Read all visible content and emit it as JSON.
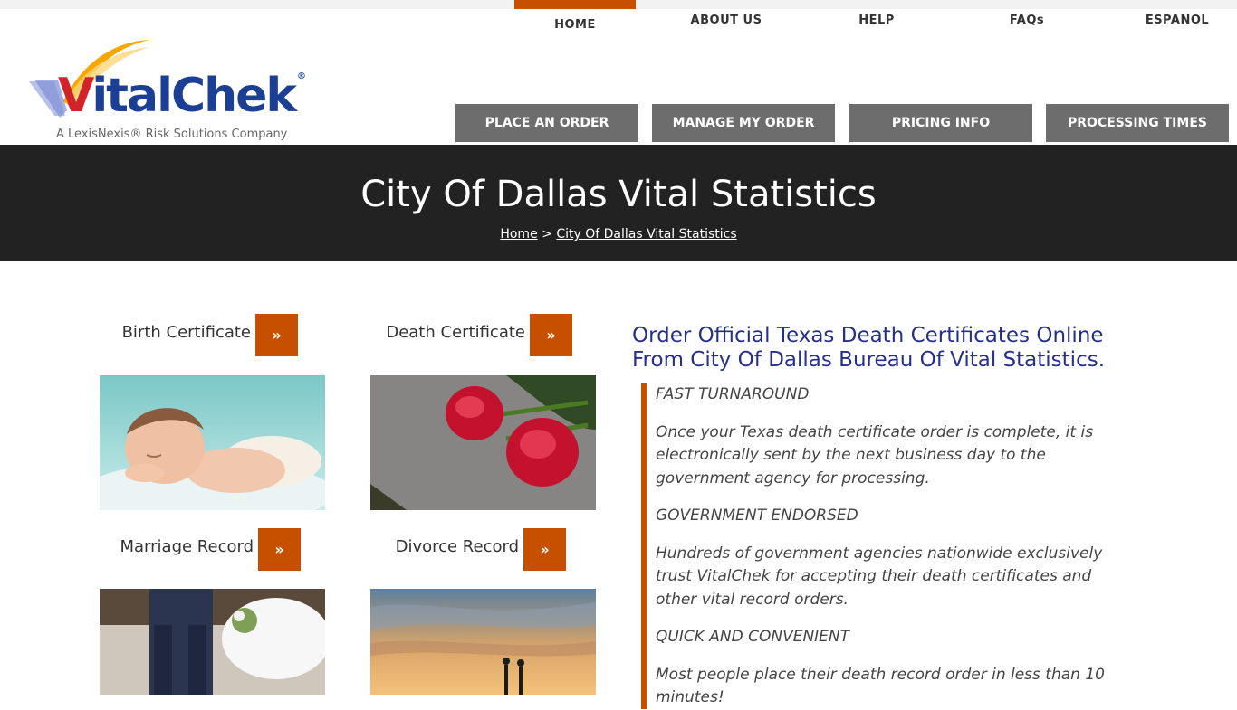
{
  "top_nav": {
    "items": [
      {
        "label": "HOME",
        "active": true
      },
      {
        "label": "ABOUT US"
      },
      {
        "label": "HELP"
      },
      {
        "label": "FAQs"
      },
      {
        "label": "ESPANOL"
      }
    ]
  },
  "logo": {
    "brand_v": "V",
    "brand_rest": "italChek",
    "registered": "®",
    "tagline": "A LexisNexis® Risk Solutions Company"
  },
  "action_nav": {
    "buttons": [
      {
        "label": "PLACE AN ORDER"
      },
      {
        "label": "MANAGE MY ORDER"
      },
      {
        "label": "PRICING INFO"
      },
      {
        "label": "PROCESSING TIMES"
      }
    ]
  },
  "hero": {
    "title": "City Of Dallas Vital Statistics",
    "breadcrumb": {
      "home": "Home",
      "separator": " > ",
      "current": "City Of Dallas Vital Statistics"
    }
  },
  "cards": [
    {
      "label": "Birth Certificate",
      "button": "»",
      "image": "sleeping-baby-photo"
    },
    {
      "label": "Death Certificate",
      "button": "»",
      "image": "red-roses-on-stone-photo"
    },
    {
      "label": "Marriage Record",
      "button": "»",
      "image": "wedding-couple-photo"
    },
    {
      "label": "Divorce Record",
      "button": "»",
      "image": "sunset-silhouette-photo"
    }
  ],
  "content": {
    "heading": "Order Official Texas Death Certificates Online From City Of Dallas Bureau Of Vital Statistics.",
    "paragraphs": [
      "FAST TURNAROUND",
      "Once your Texas death certificate order is complete, it is electronically sent by the next business day to the government agency for processing.",
      "GOVERNMENT ENDORSED",
      "Hundreds of government agencies nationwide exclusively trust VitalChek for accepting their death certificates and other vital record orders.",
      "QUICK AND CONVENIENT",
      "Most people place their death record order in less than 10 minutes!"
    ]
  },
  "colors": {
    "accent": "#c75000",
    "nav_button": "#6d6d6d",
    "hero_bg": "#222222",
    "heading": "#26308a",
    "brand_blue": "#1b3f94",
    "brand_red": "#d2232a"
  }
}
